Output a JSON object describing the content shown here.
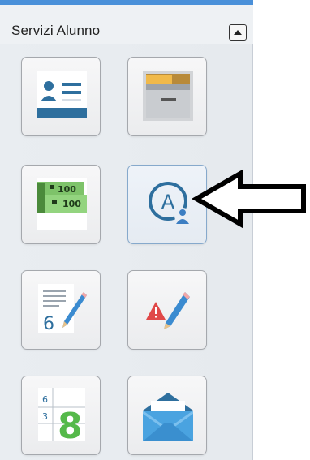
{
  "panel": {
    "title": "Servizi Alunno"
  },
  "tiles": [
    {
      "icon": "student-card-icon"
    },
    {
      "icon": "document-archive-icon"
    },
    {
      "icon": "payments-banknotes-icon",
      "note_top": "100",
      "note_bottom": "100"
    },
    {
      "icon": "absences-user-icon",
      "letter": "A"
    },
    {
      "icon": "grades-edit-icon",
      "grade": "6"
    },
    {
      "icon": "disciplinary-notes-icon"
    },
    {
      "icon": "timetable-icon",
      "small_top": "6",
      "small_bottom": "3",
      "big": "8"
    },
    {
      "icon": "messages-envelope-icon"
    }
  ],
  "colors": {
    "accent_blue": "#3c7ec2",
    "icon_teal": "#2e6f9e",
    "money_green": "#7ec36a",
    "alert_red": "#e04848",
    "pencil_blue": "#3b8bd0",
    "green_digit": "#55b94a"
  }
}
